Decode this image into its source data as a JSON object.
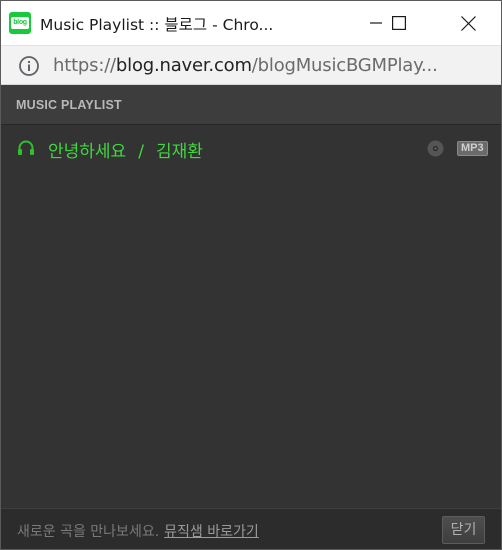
{
  "window": {
    "title": "Music Playlist :: 블로그 - Chro...",
    "app_icon_text": "blog"
  },
  "address": {
    "scheme": "https://",
    "host": "blog.naver.com",
    "path": "/blogMusicBGMPlay..."
  },
  "player": {
    "header_label": "MUSIC PLAYLIST",
    "tracks": [
      {
        "title": "안녕하세요",
        "separator": "/",
        "artist": "김재환",
        "format_badge": "MP3",
        "icons": [
          "headphone-icon",
          "disc-icon"
        ]
      }
    ],
    "footer": {
      "message": "새로운 곡을 만나보세요.",
      "link_label": "뮤직샘 바로가기",
      "close_label": "닫기"
    }
  },
  "colors": {
    "player_bg": "#333333",
    "header_bg": "#3d3d3d",
    "track_green": "#3fd93f",
    "app_icon_green": "#19c93c"
  }
}
